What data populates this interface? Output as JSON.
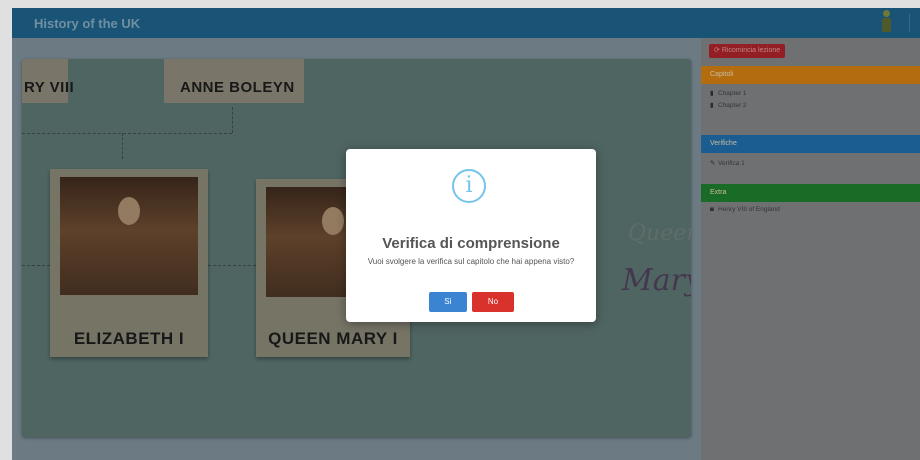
{
  "app": {
    "title": "History of the UK"
  },
  "stage": {
    "top_names": [
      "RY VIII",
      "ANNE BOLEYN"
    ],
    "cards": [
      "ELIZABETH I",
      "QUEEN MARY I"
    ],
    "script_text": {
      "queen": "Queen",
      "mary": "Mary"
    }
  },
  "sidebar": {
    "restart_label": "Ricomincia lezione",
    "sections": [
      {
        "title": "Capitoli",
        "color": "#cc7d12",
        "items": [
          "Chapter 1",
          "Chapter 2"
        ]
      },
      {
        "title": "Verifiche",
        "color": "#1f6aa6",
        "items": [
          "Verifica 1"
        ]
      },
      {
        "title": "Extra",
        "color": "#1e7a2b",
        "items": [
          "Henry VIII of England"
        ]
      }
    ]
  },
  "dialog": {
    "icon": "info-icon",
    "title": "Verifica di comprensione",
    "message": "Vuoi svolgere la verifica sul capitolo che hai appena visto?",
    "yes_label": "Sì",
    "no_label": "No"
  }
}
